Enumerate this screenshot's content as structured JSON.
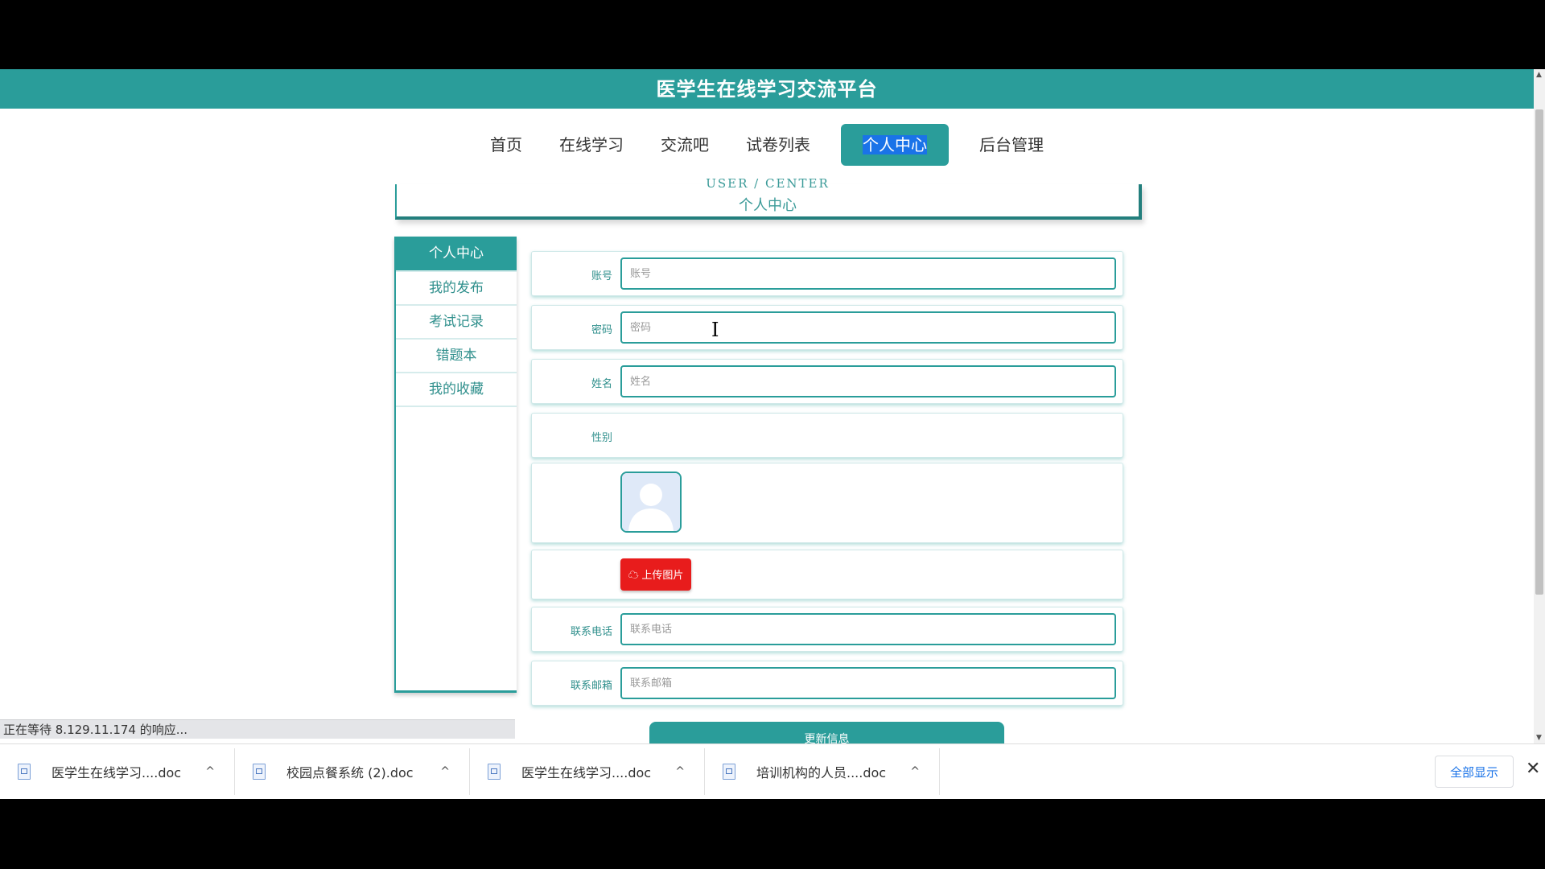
{
  "site": {
    "title": "医学生在线学习交流平台"
  },
  "nav": {
    "items": [
      {
        "label": "首页"
      },
      {
        "label": "在线学习"
      },
      {
        "label": "交流吧"
      },
      {
        "label": "试卷列表"
      },
      {
        "label": "个人中心",
        "active": true
      },
      {
        "label": "后台管理"
      }
    ]
  },
  "banner": {
    "en": "USER / CENTER",
    "cn": "个人中心"
  },
  "sidebar": {
    "items": [
      {
        "label": "个人中心",
        "active": true
      },
      {
        "label": "我的发布"
      },
      {
        "label": "考试记录"
      },
      {
        "label": "错题本"
      },
      {
        "label": "我的收藏"
      }
    ]
  },
  "form": {
    "account": {
      "label": "账号",
      "placeholder": "账号"
    },
    "password": {
      "label": "密码",
      "placeholder": "密码"
    },
    "name": {
      "label": "姓名",
      "placeholder": "姓名"
    },
    "gender": {
      "label": "性别"
    },
    "upload": {
      "label": "上传图片",
      "icon": "cloud-upload-icon"
    },
    "phone": {
      "label": "联系电话",
      "placeholder": "联系电话"
    },
    "email": {
      "label": "联系邮箱",
      "placeholder": "联系邮箱"
    },
    "submit": {
      "label": "更新信息"
    }
  },
  "status": {
    "text": "正在等待 8.129.11.174 的响应..."
  },
  "downloads": {
    "items": [
      {
        "name": "医学生在线学习....doc"
      },
      {
        "name": "校园点餐系统 (2).doc"
      },
      {
        "name": "医学生在线学习....doc"
      },
      {
        "name": "培训机构的人员....doc"
      }
    ],
    "show_all": "全部显示",
    "close": "✕"
  },
  "colors": {
    "accent": "#2a9d9a",
    "upload_button": "#e81c1c",
    "highlight": "#1a73e8"
  }
}
